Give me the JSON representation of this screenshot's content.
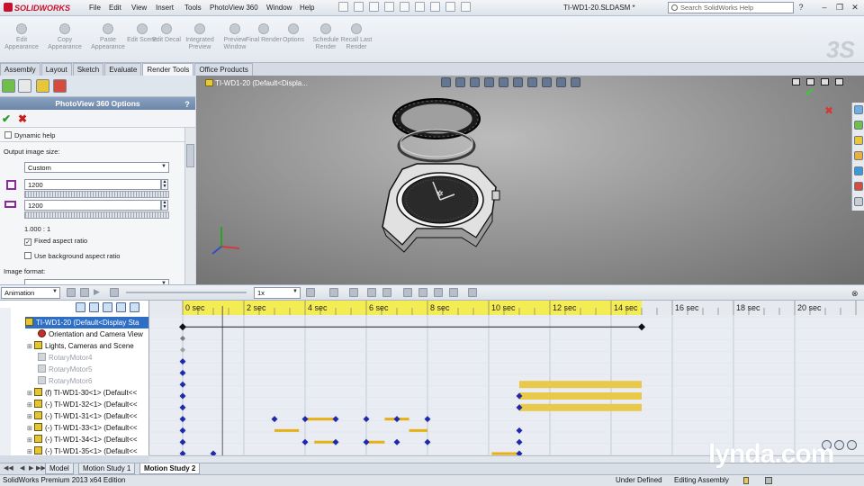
{
  "app": {
    "logo_text": "SOLIDWORKS",
    "document_title": "TI-WD1-20.SLDASM *"
  },
  "menu": [
    "File",
    "Edit",
    "View",
    "Insert",
    "Tools",
    "PhotoView 360",
    "Window",
    "Help"
  ],
  "help_search": {
    "placeholder": "Search SolidWorks Help"
  },
  "ribbon": {
    "buttons": [
      {
        "label": "Edit Appearance"
      },
      {
        "label": "Copy Appearance"
      },
      {
        "label": "Paste Appearance"
      },
      {
        "label": "Edit Scene"
      },
      {
        "label": "Edit Decal"
      },
      {
        "label": "Integrated Preview"
      },
      {
        "label": "Preview Window"
      },
      {
        "label": "Final Render"
      },
      {
        "label": "Options"
      },
      {
        "label": "Schedule Render"
      },
      {
        "label": "Recall Last Render"
      }
    ]
  },
  "command_tabs": [
    "Assembly",
    "Layout",
    "Sketch",
    "Evaluate",
    "Render Tools",
    "Office Products"
  ],
  "active_command_tab": "Render Tools",
  "photoview": {
    "title": "PhotoView 360 Options",
    "help": "?",
    "dynamic_help": "Dynamic help",
    "output_image_size_label": "Output image size:",
    "size_preset": "Custom",
    "width": "1200",
    "height": "1200",
    "aspect": "1.000 : 1",
    "fixed_aspect_label": "Fixed aspect ratio",
    "fixed_aspect_checked": true,
    "bg_aspect_label": "Use background aspect ratio",
    "bg_aspect_checked": false,
    "image_format_label": "Image format:"
  },
  "viewport": {
    "tree_flyout": "TI-WD1-20  (Default<Displa..."
  },
  "motion": {
    "study_type": "Animation",
    "playback_speed": "1x",
    "tree": [
      {
        "label": "TI-WD1-20  (Default<Display Sta",
        "kind": "root"
      },
      {
        "label": "Orientation and Camera View",
        "kind": "camera"
      },
      {
        "label": "Lights, Cameras and Scene",
        "kind": "folder"
      },
      {
        "label": "RotaryMotor4",
        "kind": "dim"
      },
      {
        "label": "RotaryMotor5",
        "kind": "dim"
      },
      {
        "label": "RotaryMotor6",
        "kind": "dim"
      },
      {
        "label": "(f) TI-WD1-30<1> (Default<<",
        "kind": "part"
      },
      {
        "label": "(-) TI-WD1-32<1> (Default<<",
        "kind": "part"
      },
      {
        "label": "(-) TI-WD1-31<1> (Default<<",
        "kind": "part"
      },
      {
        "label": "(-) TI-WD1-33<1> (Default<<",
        "kind": "part"
      },
      {
        "label": "(-) TI-WD1-34<1> (Default<<",
        "kind": "part"
      },
      {
        "label": "(-) TI-WD1-35<1> (Default<<",
        "kind": "part"
      }
    ],
    "time_ticks": [
      "0 sec",
      "2 sec",
      "4 sec",
      "6 sec",
      "8 sec",
      "10 sec",
      "12 sec",
      "14 sec",
      "16 sec",
      "18 sec",
      "20 sec"
    ],
    "duration_sec": 15,
    "timebar_sec": 1.3,
    "keys": [
      {
        "row": 3,
        "t": [
          0
        ]
      },
      {
        "row": 4,
        "t": [
          0
        ]
      },
      {
        "row": 5,
        "t": [
          0
        ]
      },
      {
        "row": 6,
        "t": [
          0,
          11
        ]
      },
      {
        "row": 7,
        "t": [
          0,
          11
        ]
      },
      {
        "row": 8,
        "t": [
          0,
          3,
          4,
          5,
          6,
          7,
          8
        ]
      },
      {
        "row": 9,
        "t": [
          0,
          11
        ]
      },
      {
        "row": 10,
        "t": [
          0,
          4,
          5,
          6,
          7,
          8,
          11
        ]
      },
      {
        "row": 11,
        "t": [
          0,
          1,
          11
        ]
      },
      {
        "row": 12,
        "t": [
          0,
          1,
          1.3,
          10,
          11
        ]
      }
    ],
    "segments": [
      {
        "row": 6,
        "from": 11,
        "to": 15,
        "style": "band"
      },
      {
        "row": 7,
        "from": 11,
        "to": 15,
        "style": "band"
      },
      {
        "row": 8,
        "from": 11,
        "to": 15,
        "style": "band"
      },
      {
        "row": 9,
        "from": 4,
        "to": 5,
        "style": "line"
      },
      {
        "row": 9,
        "from": 6.6,
        "to": 7.4,
        "style": "line"
      },
      {
        "row": 10,
        "from": 3,
        "to": 3.8,
        "style": "line"
      },
      {
        "row": 10,
        "from": 7.4,
        "to": 8,
        "style": "line"
      },
      {
        "row": 11,
        "from": 4.3,
        "to": 5,
        "style": "line"
      },
      {
        "row": 11,
        "from": 6,
        "to": 6.6,
        "style": "line"
      },
      {
        "row": 12,
        "from": 10.1,
        "to": 11,
        "style": "line"
      },
      {
        "row": 13,
        "from": 0,
        "to": 0.6,
        "style": "line"
      },
      {
        "row": 14,
        "from": 0.6,
        "to": 1.3,
        "style": "line"
      },
      {
        "row": 14,
        "from": 9.6,
        "to": 10.3,
        "style": "line"
      }
    ]
  },
  "study_tabs": [
    "Model",
    "Motion Study 1",
    "Motion Study 2"
  ],
  "active_study_tab": "Motion Study 2",
  "status": {
    "edition": "SolidWorks Premium 2013 x64 Edition",
    "state": "Under Defined",
    "mode": "Editing Assembly"
  },
  "watermark": "lynda.com",
  "colors": {
    "accent": "#2f6ec5",
    "timeline_bar": "#e8c94a",
    "key_diamond": "#1e2aa8"
  }
}
